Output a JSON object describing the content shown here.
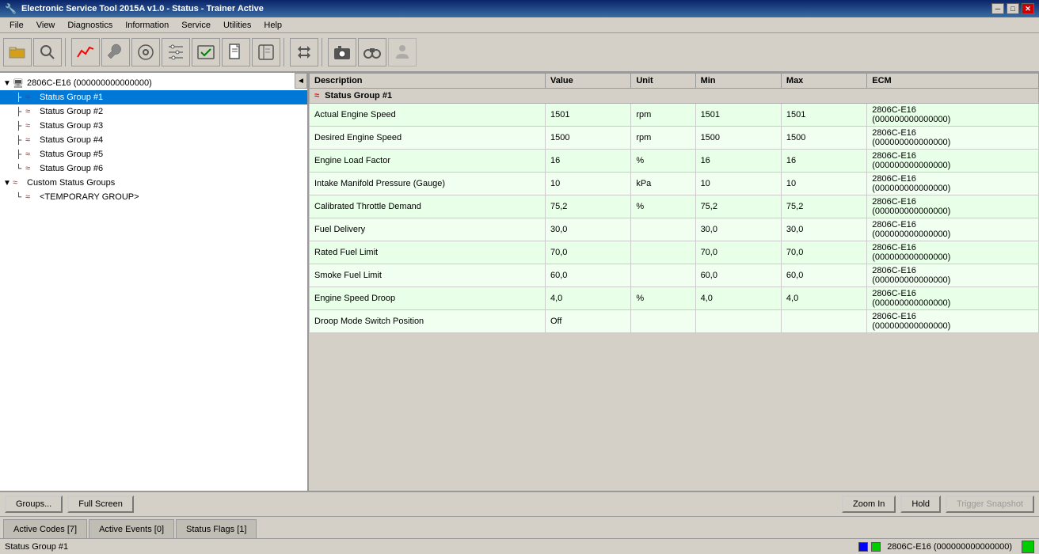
{
  "titlebar": {
    "title": "Electronic Service Tool 2015A v1.0 - Status - Trainer Active",
    "controls": [
      "minimize",
      "maximize",
      "close"
    ]
  },
  "menubar": {
    "items": [
      "File",
      "View",
      "Diagnostics",
      "Information",
      "Service",
      "Utilities",
      "Help"
    ]
  },
  "left_panel": {
    "tree": [
      {
        "id": "root",
        "label": "2806C-E16 (000000000000000)",
        "level": 0,
        "type": "device",
        "expanded": true
      },
      {
        "id": "sg1",
        "label": "Status Group #1",
        "level": 1,
        "type": "group",
        "selected": true
      },
      {
        "id": "sg2",
        "label": "Status Group #2",
        "level": 1,
        "type": "group"
      },
      {
        "id": "sg3",
        "label": "Status Group #3",
        "level": 1,
        "type": "group"
      },
      {
        "id": "sg4",
        "label": "Status Group #4",
        "level": 1,
        "type": "group"
      },
      {
        "id": "sg5",
        "label": "Status Group #5",
        "level": 1,
        "type": "group"
      },
      {
        "id": "sg6",
        "label": "Status Group #6",
        "level": 1,
        "type": "group"
      },
      {
        "id": "csg",
        "label": "Custom Status Groups",
        "level": 0,
        "type": "custom",
        "expanded": true
      },
      {
        "id": "tg",
        "label": "<TEMPORARY GROUP>",
        "level": 1,
        "type": "temp"
      }
    ]
  },
  "grid": {
    "columns": [
      "Description",
      "Value",
      "Unit",
      "Min",
      "Max",
      "ECM"
    ],
    "group_header": "Status Group #1",
    "rows": [
      {
        "desc": "Actual Engine Speed",
        "value": "1501",
        "unit": "rpm",
        "min": "1501",
        "max": "1501",
        "ecm": "2806C-E16\n(000000000000000)"
      },
      {
        "desc": "Desired Engine Speed",
        "value": "1500",
        "unit": "rpm",
        "min": "1500",
        "max": "1500",
        "ecm": "2806C-E16\n(000000000000000)"
      },
      {
        "desc": "Engine Load Factor",
        "value": "16",
        "unit": "%",
        "min": "16",
        "max": "16",
        "ecm": "2806C-E16\n(000000000000000)"
      },
      {
        "desc": "Intake Manifold Pressure (Gauge)",
        "value": "10",
        "unit": "kPa",
        "min": "10",
        "max": "10",
        "ecm": "2806C-E16\n(000000000000000)"
      },
      {
        "desc": "Calibrated Throttle Demand",
        "value": "75,2",
        "unit": "%",
        "min": "75,2",
        "max": "75,2",
        "ecm": "2806C-E16\n(000000000000000)"
      },
      {
        "desc": "Fuel Delivery",
        "value": "30,0",
        "unit": "",
        "min": "30,0",
        "max": "30,0",
        "ecm": "2806C-E16\n(000000000000000)"
      },
      {
        "desc": "Rated Fuel Limit",
        "value": "70,0",
        "unit": "",
        "min": "70,0",
        "max": "70,0",
        "ecm": "2806C-E16\n(000000000000000)"
      },
      {
        "desc": "Smoke Fuel Limit",
        "value": "60,0",
        "unit": "",
        "min": "60,0",
        "max": "60,0",
        "ecm": "2806C-E16\n(000000000000000)"
      },
      {
        "desc": "Engine Speed Droop",
        "value": "4,0",
        "unit": "%",
        "min": "4,0",
        "max": "4,0",
        "ecm": "2806C-E16\n(000000000000000)"
      },
      {
        "desc": "Droop Mode Switch Position",
        "value": "Off",
        "unit": "",
        "min": "",
        "max": "",
        "ecm": "2806C-E16\n(000000000000000)"
      }
    ]
  },
  "bottom_toolbar": {
    "groups_btn": "Groups...",
    "fullscreen_btn": "Full Screen",
    "zoom_in_btn": "Zoom In",
    "hold_btn": "Hold",
    "trigger_snapshot_btn": "Trigger Snapshot"
  },
  "tabs": [
    {
      "label": "Active Codes [7]",
      "active": false
    },
    {
      "label": "Active Events [0]",
      "active": false
    },
    {
      "label": "Status Flags [1]",
      "active": false
    }
  ],
  "statusbar": {
    "left_text": "Status Group #1",
    "ecm_text": "2806C-E16 (000000000000000)"
  },
  "toolbar_icons": [
    {
      "name": "open",
      "symbol": "📂"
    },
    {
      "name": "search",
      "symbol": "🔍"
    },
    {
      "name": "graph",
      "symbol": "📈"
    },
    {
      "name": "wrench",
      "symbol": "🔧"
    },
    {
      "name": "tools",
      "symbol": "⚙"
    },
    {
      "name": "settings2",
      "symbol": "🔩"
    },
    {
      "name": "check",
      "symbol": "✔"
    },
    {
      "name": "document",
      "symbol": "📄"
    },
    {
      "name": "book",
      "symbol": "📋"
    },
    {
      "name": "sep1",
      "type": "sep"
    },
    {
      "name": "arrows",
      "symbol": "↔"
    },
    {
      "name": "sep2",
      "type": "sep"
    },
    {
      "name": "camera",
      "symbol": "📷"
    },
    {
      "name": "binoculars",
      "symbol": "🔭"
    },
    {
      "name": "person",
      "symbol": "👤"
    }
  ]
}
